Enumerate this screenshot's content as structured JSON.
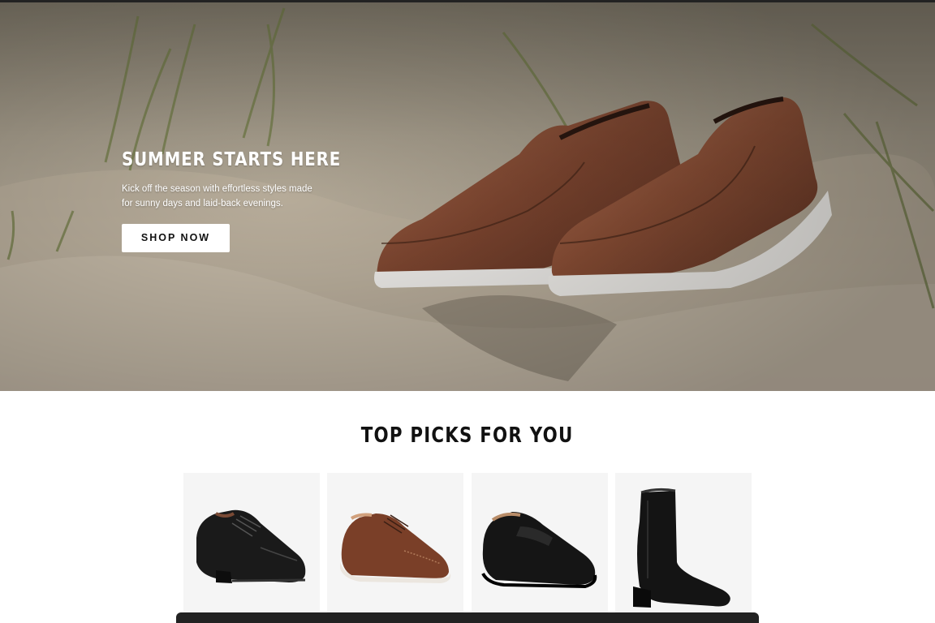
{
  "hero": {
    "title": "SUMMER STARTS HERE",
    "text": "Kick off the season with effortless styles made for sunny days and laid-back evenings.",
    "cta_label": "SHOP NOW",
    "image_icon": "brown-loafers-on-sand-image"
  },
  "picks": {
    "title": "TOP PICKS FOR YOU",
    "products": [
      {
        "icon": "black-cap-toe-oxford-image"
      },
      {
        "icon": "brown-wingtip-oxford-image"
      },
      {
        "icon": "black-slip-on-loafer-image"
      },
      {
        "icon": "black-zip-boot-image"
      }
    ]
  },
  "colors": {
    "hero_text": "#ffffff",
    "button_bg": "#ffffff",
    "button_text": "#111111",
    "heading": "#111111",
    "card_bg": "#f5f5f5",
    "bottom_bar": "#222222"
  }
}
